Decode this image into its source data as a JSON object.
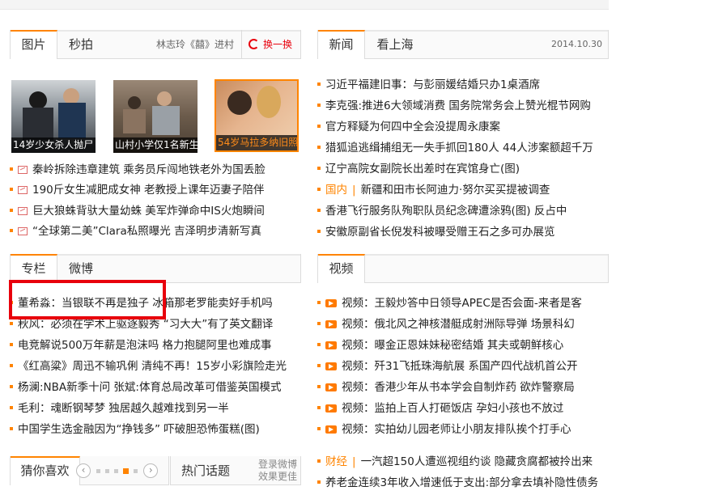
{
  "pics_panel": {
    "tabs": [
      "图片",
      "秒拍"
    ],
    "extra_text": "林志玲《囍》进村",
    "refresh_label": "换一换",
    "photos": [
      {
        "caption": "14岁少女杀人抛尸"
      },
      {
        "caption": "山村小学仅1名新生"
      },
      {
        "caption": "54岁马拉多纳旧照"
      }
    ],
    "items": [
      "秦岭拆除违章建筑  乘务员斥闯地铁老外为国丢脸",
      "190斤女生减肥成女神  老教授上课年迈妻子陪伴",
      "巨大狼蛛背驮大量幼蛛  美军炸弹命中IS火炮瞬间",
      "“全球第二美”Clara私照曝光  吉泽明步清新写真"
    ]
  },
  "news_panel": {
    "tabs": [
      "新闻",
      "看上海"
    ],
    "date": "2014.10.30",
    "items": [
      {
        "text": "习近平福建旧事：与彭丽媛结婚只办1桌酒席"
      },
      {
        "text": "李克强:推进6大领域消费  国务院常务会上赞光棍节网购"
      },
      {
        "text": "官方释疑为何四中全会没提周永康案"
      },
      {
        "text": "猎狐追逃缉捕组无一失手抓回180人  44人涉案额超千万"
      },
      {
        "text": "辽宁高院女副院长出差时在宾馆身亡(图)"
      },
      {
        "cat": "国内",
        "text": "新疆和田市长阿迪力·努尔买买提被调查"
      },
      {
        "text": "香港飞行服务队殉职队员纪念碑遭涂鸦(图)  反占中"
      },
      {
        "text": "安徽原副省长倪发科被曝受赠王石之多可办展览"
      }
    ]
  },
  "column_panel": {
    "tabs": [
      "专栏",
      "微博"
    ],
    "items": [
      "董希淼：当银联不再是独子  冰箱那老罗能卖好手机吗",
      "秋风：必须在学术上驱逐毅秀  “习大大”有了英文翻译",
      "电竞解说500万年薪是泡沫吗  格力抱腿阿里也难成事",
      "《红高粱》周迅不输巩俐  清纯不再！15岁小彩旗险走光",
      "杨澜:NBA新季十问  张斌:体育总局改革可借鉴英国模式",
      "毛利：魂断钢琴梦  独居越久越难找到另一半",
      "中国学生选金融因为“挣钱多”  吓破胆恐怖蛋糕(图)"
    ]
  },
  "video_panel": {
    "tabs": [
      "视频"
    ],
    "items": [
      "视频：王毅炒答中日领导APEC是否会面-来者是客",
      "视频：俄北风之神核潜艇成射洲际导弹  场景科幻",
      "视频：曝金正恩妹妹秘密结婚  其夫或朝鲜核心",
      "视频：歼31飞抵珠海航展  系国产四代战机首公开",
      "视频：香港少年从书本学会自制炸药  欲炸警察局",
      "视频：监拍上百人打砸饭店  孕妇小孩也不放过",
      "视频：实拍幼儿园老师让小朋友排队挨个打手心"
    ]
  },
  "bottom_left": {
    "tab": "猜你喜欢",
    "prev": "‹",
    "next": "›",
    "tab2": "热门话题",
    "extra_line1": "登录微博",
    "extra_line2": "效果更佳"
  },
  "bottom_right": {
    "items": [
      {
        "cat": "财经",
        "text": "一汽超150人遭巡视组约谈  隐藏贪腐都被拎出来"
      },
      {
        "text": "养老金连续3年收入增速低于支出:部分拿去填补隐性债务"
      }
    ]
  },
  "colors": {
    "accent": "#ff8400",
    "highlight": "#e8000c",
    "text": "#222222"
  }
}
